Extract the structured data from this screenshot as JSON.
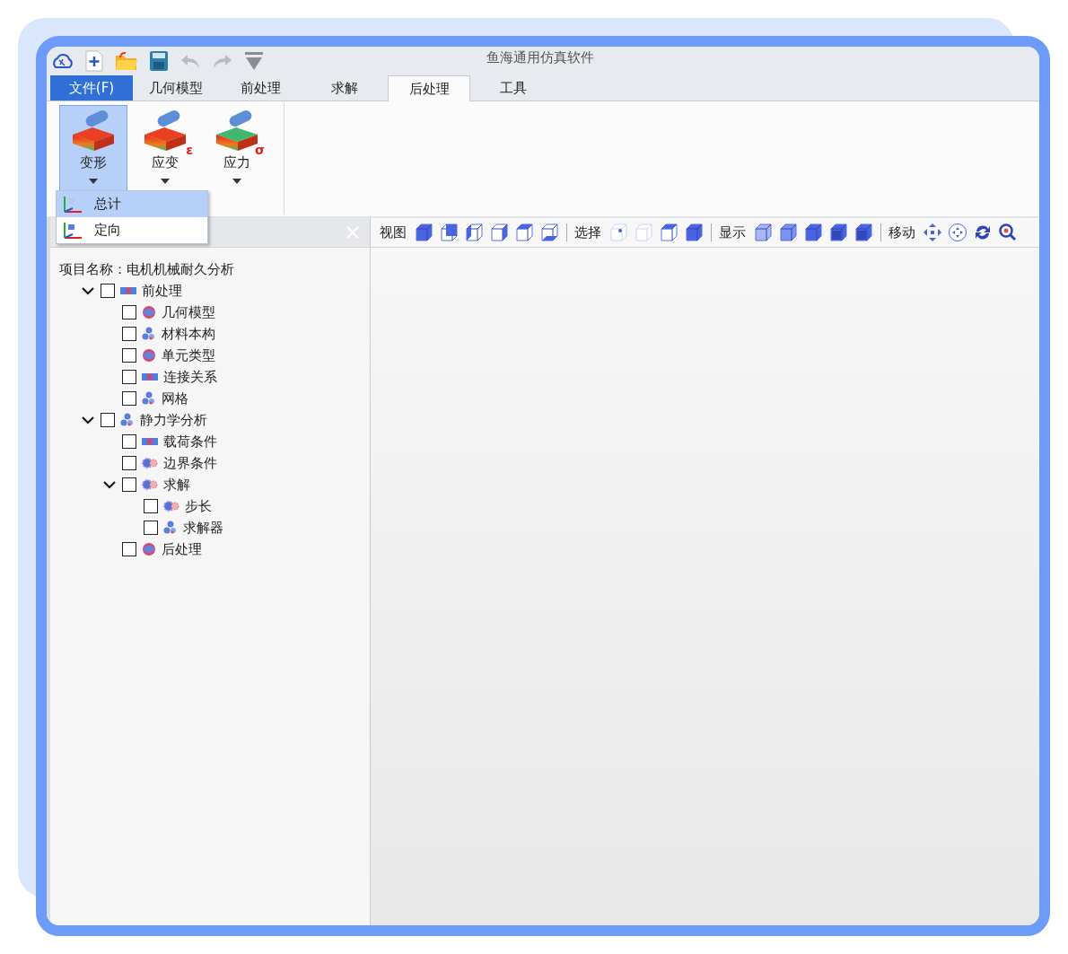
{
  "window": {
    "title": "鱼海通用仿真软件"
  },
  "tabs": [
    {
      "label": "文件(F)",
      "kind": "file",
      "selected": false
    },
    {
      "label": "几何模型",
      "kind": "tab",
      "selected": false
    },
    {
      "label": "前处理",
      "kind": "tab",
      "selected": false
    },
    {
      "label": "求解",
      "kind": "tab",
      "selected": false
    },
    {
      "label": "后处理",
      "kind": "tab",
      "selected": true
    },
    {
      "label": "工具",
      "kind": "tab",
      "selected": false
    }
  ],
  "ribbon": [
    {
      "label": "变形",
      "kind": "deform",
      "selected": true
    },
    {
      "label": "应变",
      "kind": "strain",
      "symbol": "ε",
      "selected": false
    },
    {
      "label": "应力",
      "kind": "stress",
      "symbol": "σ",
      "selected": false
    }
  ],
  "dropdown": [
    {
      "label": "总计",
      "selected": true
    },
    {
      "label": "定向",
      "selected": false
    }
  ],
  "toolbar": [
    {
      "label": "视图"
    },
    {
      "label": "选择"
    },
    {
      "label": "显示"
    },
    {
      "label": "移动"
    }
  ],
  "tree": {
    "project_label": "项目名称：电机机械耐久分析",
    "items": [
      {
        "label": "前处理",
        "kind": "bar",
        "checked": false,
        "expanded": true,
        "children": [
          {
            "label": "几何模型",
            "kind": "disc",
            "checked": false
          },
          {
            "label": "材料本构",
            "kind": "cluster",
            "checked": false
          },
          {
            "label": "单元类型",
            "kind": "disc",
            "checked": false
          },
          {
            "label": "连接关系",
            "kind": "bar",
            "checked": false
          },
          {
            "label": "网格",
            "kind": "cluster",
            "checked": false
          }
        ]
      },
      {
        "label": "静力学分析",
        "kind": "cluster",
        "checked": false,
        "expanded": true,
        "children": [
          {
            "label": "载荷条件",
            "kind": "bar",
            "checked": false
          },
          {
            "label": "边界条件",
            "kind": "gears",
            "checked": false
          },
          {
            "label": "求解",
            "kind": "gears",
            "checked": false,
            "expanded": true,
            "children": [
              {
                "label": "步长",
                "kind": "gears",
                "checked": false
              },
              {
                "label": "求解器",
                "kind": "cluster",
                "checked": false
              }
            ]
          },
          {
            "label": "后处理",
            "kind": "disc",
            "checked": false
          }
        ]
      }
    ]
  }
}
